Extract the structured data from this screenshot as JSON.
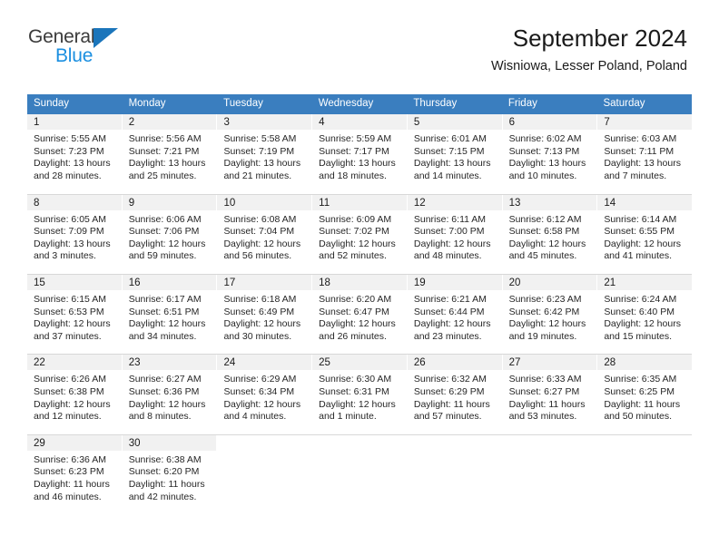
{
  "brand": {
    "line1": "General",
    "line2": "Blue",
    "flag_icon": "triangle-flag-icon",
    "accent_color": "#1b75bb",
    "blue_text_color": "#1b8fe0"
  },
  "header": {
    "title": "September 2024",
    "location": "Wisniowa, Lesser Poland, Poland"
  },
  "calendar": {
    "header_bg_color": "#3a7ebf",
    "daynum_band_color": "#f1f1f1",
    "weekday_headers": [
      "Sunday",
      "Monday",
      "Tuesday",
      "Wednesday",
      "Thursday",
      "Friday",
      "Saturday"
    ],
    "weeks": [
      [
        {
          "day": "1",
          "sunrise": "Sunrise: 5:55 AM",
          "sunset": "Sunset: 7:23 PM",
          "daylight1": "Daylight: 13 hours",
          "daylight2": "and 28 minutes."
        },
        {
          "day": "2",
          "sunrise": "Sunrise: 5:56 AM",
          "sunset": "Sunset: 7:21 PM",
          "daylight1": "Daylight: 13 hours",
          "daylight2": "and 25 minutes."
        },
        {
          "day": "3",
          "sunrise": "Sunrise: 5:58 AM",
          "sunset": "Sunset: 7:19 PM",
          "daylight1": "Daylight: 13 hours",
          "daylight2": "and 21 minutes."
        },
        {
          "day": "4",
          "sunrise": "Sunrise: 5:59 AM",
          "sunset": "Sunset: 7:17 PM",
          "daylight1": "Daylight: 13 hours",
          "daylight2": "and 18 minutes."
        },
        {
          "day": "5",
          "sunrise": "Sunrise: 6:01 AM",
          "sunset": "Sunset: 7:15 PM",
          "daylight1": "Daylight: 13 hours",
          "daylight2": "and 14 minutes."
        },
        {
          "day": "6",
          "sunrise": "Sunrise: 6:02 AM",
          "sunset": "Sunset: 7:13 PM",
          "daylight1": "Daylight: 13 hours",
          "daylight2": "and 10 minutes."
        },
        {
          "day": "7",
          "sunrise": "Sunrise: 6:03 AM",
          "sunset": "Sunset: 7:11 PM",
          "daylight1": "Daylight: 13 hours",
          "daylight2": "and 7 minutes."
        }
      ],
      [
        {
          "day": "8",
          "sunrise": "Sunrise: 6:05 AM",
          "sunset": "Sunset: 7:09 PM",
          "daylight1": "Daylight: 13 hours",
          "daylight2": "and 3 minutes."
        },
        {
          "day": "9",
          "sunrise": "Sunrise: 6:06 AM",
          "sunset": "Sunset: 7:06 PM",
          "daylight1": "Daylight: 12 hours",
          "daylight2": "and 59 minutes."
        },
        {
          "day": "10",
          "sunrise": "Sunrise: 6:08 AM",
          "sunset": "Sunset: 7:04 PM",
          "daylight1": "Daylight: 12 hours",
          "daylight2": "and 56 minutes."
        },
        {
          "day": "11",
          "sunrise": "Sunrise: 6:09 AM",
          "sunset": "Sunset: 7:02 PM",
          "daylight1": "Daylight: 12 hours",
          "daylight2": "and 52 minutes."
        },
        {
          "day": "12",
          "sunrise": "Sunrise: 6:11 AM",
          "sunset": "Sunset: 7:00 PM",
          "daylight1": "Daylight: 12 hours",
          "daylight2": "and 48 minutes."
        },
        {
          "day": "13",
          "sunrise": "Sunrise: 6:12 AM",
          "sunset": "Sunset: 6:58 PM",
          "daylight1": "Daylight: 12 hours",
          "daylight2": "and 45 minutes."
        },
        {
          "day": "14",
          "sunrise": "Sunrise: 6:14 AM",
          "sunset": "Sunset: 6:55 PM",
          "daylight1": "Daylight: 12 hours",
          "daylight2": "and 41 minutes."
        }
      ],
      [
        {
          "day": "15",
          "sunrise": "Sunrise: 6:15 AM",
          "sunset": "Sunset: 6:53 PM",
          "daylight1": "Daylight: 12 hours",
          "daylight2": "and 37 minutes."
        },
        {
          "day": "16",
          "sunrise": "Sunrise: 6:17 AM",
          "sunset": "Sunset: 6:51 PM",
          "daylight1": "Daylight: 12 hours",
          "daylight2": "and 34 minutes."
        },
        {
          "day": "17",
          "sunrise": "Sunrise: 6:18 AM",
          "sunset": "Sunset: 6:49 PM",
          "daylight1": "Daylight: 12 hours",
          "daylight2": "and 30 minutes."
        },
        {
          "day": "18",
          "sunrise": "Sunrise: 6:20 AM",
          "sunset": "Sunset: 6:47 PM",
          "daylight1": "Daylight: 12 hours",
          "daylight2": "and 26 minutes."
        },
        {
          "day": "19",
          "sunrise": "Sunrise: 6:21 AM",
          "sunset": "Sunset: 6:44 PM",
          "daylight1": "Daylight: 12 hours",
          "daylight2": "and 23 minutes."
        },
        {
          "day": "20",
          "sunrise": "Sunrise: 6:23 AM",
          "sunset": "Sunset: 6:42 PM",
          "daylight1": "Daylight: 12 hours",
          "daylight2": "and 19 minutes."
        },
        {
          "day": "21",
          "sunrise": "Sunrise: 6:24 AM",
          "sunset": "Sunset: 6:40 PM",
          "daylight1": "Daylight: 12 hours",
          "daylight2": "and 15 minutes."
        }
      ],
      [
        {
          "day": "22",
          "sunrise": "Sunrise: 6:26 AM",
          "sunset": "Sunset: 6:38 PM",
          "daylight1": "Daylight: 12 hours",
          "daylight2": "and 12 minutes."
        },
        {
          "day": "23",
          "sunrise": "Sunrise: 6:27 AM",
          "sunset": "Sunset: 6:36 PM",
          "daylight1": "Daylight: 12 hours",
          "daylight2": "and 8 minutes."
        },
        {
          "day": "24",
          "sunrise": "Sunrise: 6:29 AM",
          "sunset": "Sunset: 6:34 PM",
          "daylight1": "Daylight: 12 hours",
          "daylight2": "and 4 minutes."
        },
        {
          "day": "25",
          "sunrise": "Sunrise: 6:30 AM",
          "sunset": "Sunset: 6:31 PM",
          "daylight1": "Daylight: 12 hours",
          "daylight2": "and 1 minute."
        },
        {
          "day": "26",
          "sunrise": "Sunrise: 6:32 AM",
          "sunset": "Sunset: 6:29 PM",
          "daylight1": "Daylight: 11 hours",
          "daylight2": "and 57 minutes."
        },
        {
          "day": "27",
          "sunrise": "Sunrise: 6:33 AM",
          "sunset": "Sunset: 6:27 PM",
          "daylight1": "Daylight: 11 hours",
          "daylight2": "and 53 minutes."
        },
        {
          "day": "28",
          "sunrise": "Sunrise: 6:35 AM",
          "sunset": "Sunset: 6:25 PM",
          "daylight1": "Daylight: 11 hours",
          "daylight2": "and 50 minutes."
        }
      ],
      [
        {
          "day": "29",
          "sunrise": "Sunrise: 6:36 AM",
          "sunset": "Sunset: 6:23 PM",
          "daylight1": "Daylight: 11 hours",
          "daylight2": "and 46 minutes."
        },
        {
          "day": "30",
          "sunrise": "Sunrise: 6:38 AM",
          "sunset": "Sunset: 6:20 PM",
          "daylight1": "Daylight: 11 hours",
          "daylight2": "and 42 minutes."
        },
        {
          "day": "",
          "sunrise": "",
          "sunset": "",
          "daylight1": "",
          "daylight2": ""
        },
        {
          "day": "",
          "sunrise": "",
          "sunset": "",
          "daylight1": "",
          "daylight2": ""
        },
        {
          "day": "",
          "sunrise": "",
          "sunset": "",
          "daylight1": "",
          "daylight2": ""
        },
        {
          "day": "",
          "sunrise": "",
          "sunset": "",
          "daylight1": "",
          "daylight2": ""
        },
        {
          "day": "",
          "sunrise": "",
          "sunset": "",
          "daylight1": "",
          "daylight2": ""
        }
      ]
    ]
  }
}
